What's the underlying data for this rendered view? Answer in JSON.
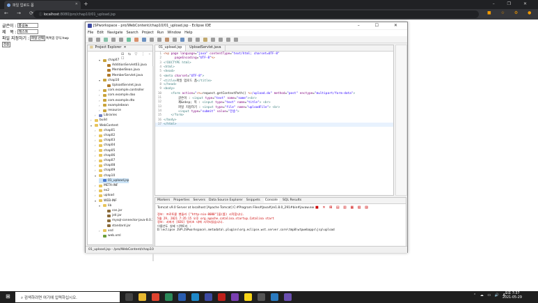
{
  "browser": {
    "tab_title": "파일 업로드 폼",
    "tab_close": "✕",
    "new_tab": "+",
    "window_controls": "–  ❐  ✕",
    "nav_buttons": "←  →  ⟳",
    "address_host": "localhost",
    "address_path": ":8080/pro/chap10/01_upload.jsp"
  },
  "page_form": {
    "writer_label": "글쓴이 :",
    "writer_value": "홍길동",
    "title_label": "제   목 :",
    "title_value": "테스트",
    "file_label": "파일 지정하기 :",
    "file_button": "파일 선택",
    "file_status": "톡톡업 양식.hwp",
    "submit_label": "전송"
  },
  "ide": {
    "title": "JSPworkspace - pro/WebContent/chap10/01_upload.jsp - Eclipse IDE",
    "window_controls": "–  ☐  ✕",
    "menu": [
      "File",
      "Edit",
      "Navigate",
      "Search",
      "Project",
      "Run",
      "Window",
      "Help"
    ],
    "project_explorer_title": "Project Explorer",
    "tree": [
      {
        "label": "chap07",
        "indent": 3,
        "kind": "pkg",
        "open": true
      },
      {
        "label": "AdditionServlet03.java",
        "indent": 4,
        "kind": "java"
      },
      {
        "label": "MemberBean.java",
        "indent": 4,
        "kind": "java"
      },
      {
        "label": "MemberServlet.java",
        "indent": 4,
        "kind": "java"
      },
      {
        "label": "chap10",
        "indent": 3,
        "kind": "pkg",
        "open": true
      },
      {
        "label": "UploadServlet.java",
        "indent": 4,
        "kind": "java"
      },
      {
        "label": "com.example.controller",
        "indent": 3,
        "kind": "pkg"
      },
      {
        "label": "com.example.dao",
        "indent": 3,
        "kind": "pkg"
      },
      {
        "label": "com.example.dto",
        "indent": 3,
        "kind": "pkg"
      },
      {
        "label": "examplebean",
        "indent": 3,
        "kind": "pkg"
      },
      {
        "label": "resource",
        "indent": 3,
        "kind": "pkg"
      },
      {
        "label": "Libraries",
        "indent": 2,
        "kind": "lib"
      },
      {
        "label": "build",
        "indent": 1,
        "kind": "folder"
      },
      {
        "label": "WebContent",
        "indent": 1,
        "kind": "folder",
        "open": true
      },
      {
        "label": "chap01",
        "indent": 2,
        "kind": "folder"
      },
      {
        "label": "chap02",
        "indent": 2,
        "kind": "folder"
      },
      {
        "label": "chap03",
        "indent": 2,
        "kind": "folder"
      },
      {
        "label": "chap04",
        "indent": 2,
        "kind": "folder"
      },
      {
        "label": "chap05",
        "indent": 2,
        "kind": "folder"
      },
      {
        "label": "chap06",
        "indent": 2,
        "kind": "folder"
      },
      {
        "label": "chap07",
        "indent": 2,
        "kind": "folder"
      },
      {
        "label": "chap08",
        "indent": 2,
        "kind": "folder"
      },
      {
        "label": "chap09",
        "indent": 2,
        "kind": "folder"
      },
      {
        "label": "chap10",
        "indent": 2,
        "kind": "folder",
        "open": true
      },
      {
        "label": "01_upload.jsp",
        "indent": 3,
        "kind": "jsp",
        "selected": true
      },
      {
        "label": "META-INF",
        "indent": 2,
        "kind": "folder"
      },
      {
        "label": "ex2",
        "indent": 2,
        "kind": "folder"
      },
      {
        "label": "upload",
        "indent": 2,
        "kind": "folder"
      },
      {
        "label": "WEB-INF",
        "indent": 2,
        "kind": "folder",
        "open": true
      },
      {
        "label": "lib",
        "indent": 3,
        "kind": "folder",
        "open": true
      },
      {
        "label": "cos.jar",
        "indent": 4,
        "kind": "jar"
      },
      {
        "label": "jstl.jar",
        "indent": 4,
        "kind": "jar"
      },
      {
        "label": "mysql-connector-java-8.0.2",
        "indent": 4,
        "kind": "jar"
      },
      {
        "label": "standard.jar",
        "indent": 4,
        "kind": "jar"
      },
      {
        "label": "xsd",
        "indent": 3,
        "kind": "folder"
      },
      {
        "label": "web.xml",
        "indent": 3,
        "kind": "xml"
      }
    ],
    "editor_tabs": [
      "01_upload.jsp",
      "UploadServlet.java"
    ],
    "code_lines": [
      {
        "n": "1",
        "html": "<span class='jsp'>&lt;%@</span> <span class='at'>page</span> <span class='at'>language</span>=<span class='st'>\"java\"</span> <span class='at'>contentType</span>=<span class='st'>\"text/html; charset=UTF-8\"</span>"
      },
      {
        "n": "2",
        "html": "      <span class='at'>pageEncoding</span>=<span class='st'>\"UTF-8\"</span><span class='jsp'>%&gt;</span>"
      },
      {
        "n": "3",
        "html": "<span class='tg'>&lt;!DOCTYPE html&gt;</span>"
      },
      {
        "n": "4",
        "html": "<span class='tg'>&lt;html&gt;</span>"
      },
      {
        "n": "5",
        "html": "<span class='tg'>&lt;head&gt;</span>"
      },
      {
        "n": "6",
        "html": "<span class='tg'>&lt;meta</span> <span class='at'>charset</span>=<span class='st'>\"UTF-8\"</span><span class='tg'>&gt;</span>"
      },
      {
        "n": "7",
        "html": "<span class='tg'>&lt;title&gt;</span>파일 업로드 폼<span class='tg'>&lt;/title&gt;</span>"
      },
      {
        "n": "8",
        "html": "<span class='tg'>&lt;/head&gt;</span>"
      },
      {
        "n": "9",
        "html": "<span class='tg'>&lt;body&gt;</span>"
      },
      {
        "n": "10",
        "html": "    <span class='tg'>&lt;form</span> <span class='at'>action</span>=<span class='st'>\"</span><span class='jsp'>&lt;%=</span>request.getContextPath() <span class='jsp'>%&gt;</span><span class='st'>/upload.do\"</span> <span class='at'>method</span>=<span class='st'>\"post\"</span> <span class='at'>enctype</span>=<span class='st'>\"multipart/form-data\"</span><span class='tg'>&gt;</span>"
      },
      {
        "n": "11",
        "html": "        글쓴이 : <span class='tg'>&lt;input</span> <span class='at'>type</span>=<span class='st'>\"text\"</span> <span class='at'>name</span>=<span class='st'>\"name\"</span><span class='tg'>&gt;&lt;br&gt;</span>"
      },
      {
        "n": "12",
        "html": "        제&amp;nbsp; 목 : <span class='tg'>&lt;input</span> <span class='at'>type</span>=<span class='st'>\"text\"</span> <span class='at'>name</span>=<span class='st'>\"title\"</span><span class='tg'>&gt;</span> <span class='tg'>&lt;br&gt;</span>"
      },
      {
        "n": "13",
        "html": "        파일 지정하기 : <span class='tg'>&lt;input</span> <span class='at'>type</span>=<span class='st'>\"file\"</span> <span class='at'>name</span>=<span class='st'>\"uploadFile\"</span><span class='tg'>&gt;</span> <span class='tg'>&lt;br&gt;</span>"
      },
      {
        "n": "14",
        "html": "        <span class='tg'>&lt;input</span> <span class='at'>type</span>=<span class='st'>\"submit\"</span> <span class='at'>value</span>=<span class='st'>\"전송\"</span><span class='tg'>&gt;</span>"
      },
      {
        "n": "15",
        "html": "    <span class='tg'>&lt;/form&gt;</span>"
      },
      {
        "n": "16",
        "html": "<span class='tg'>&lt;/body&gt;</span>"
      },
      {
        "n": "17",
        "html": "<span class='tg'>&lt;/html&gt;</span>"
      }
    ],
    "console_tabs": [
      "Markers",
      "Properties",
      "Servers",
      "Data Source Explorer",
      "Snippets",
      "Console",
      "SQL Results"
    ],
    "console_header": "Tomcat v9.0 Server at localhost [Apache Tomcat] C:#Program Files#Java#jre1.8.0_291#bin#javaw.exe  (2021. 5. 29. 오후 7:35:14)",
    "console_lines": [
      {
        "text": "정보: 프로토콜 핸들러 [\"http-nio-8080\"]을(를) 시작합니다.",
        "red": true
      },
      {
        "text": "5월 29, 2021 7:35:15 오후 org.apache.catalina.startup.Catalina start",
        "red": true
      },
      {
        "text": "정보: 서버가 [826] 밀리초 내에 시작되었습니다.",
        "red": true
      },
      {
        "text": "이름년도 실제 디렉토리 :",
        "red": false
      },
      {
        "text": "D:\\eclipse JSP\\JSPworkspace\\.metadata\\.plugins\\org.eclipse.wst.server.core\\tmp0\\wtpwebapps\\jsp\\upload",
        "red": false
      }
    ],
    "status_bar": "01_upload.jsp - /pro/WebContent/chap10"
  },
  "taskbar": {
    "search_placeholder": "검색하려면 여기에 입력하십시오.",
    "time": "오후 7:37",
    "date": "2021-05-29",
    "tray_icons": "⌃ ☁ ▭ 🔊 A"
  },
  "colors": {
    "java": "#b07a2a",
    "pkg": "#c9a33b",
    "folder": "#e8c45a",
    "jsp": "#4a7bd0",
    "jar": "#8a6b3a",
    "xml": "#6a9d3a",
    "lib": "#6f7fc0"
  }
}
